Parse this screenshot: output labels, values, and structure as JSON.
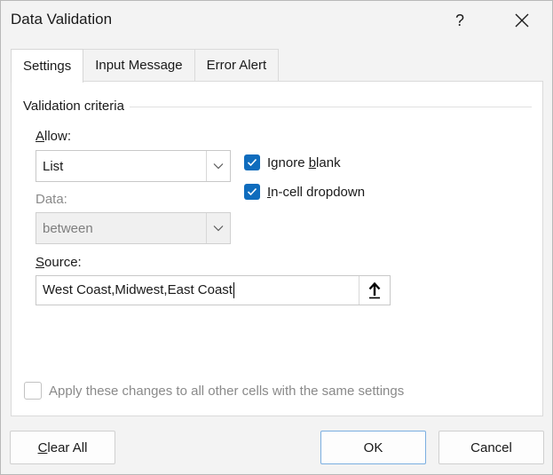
{
  "window": {
    "title": "Data Validation",
    "help_label": "?"
  },
  "tabs": [
    {
      "label": "Settings",
      "active": true
    },
    {
      "label": "Input Message",
      "active": false
    },
    {
      "label": "Error Alert",
      "active": false
    }
  ],
  "settings": {
    "group_label": "Validation criteria",
    "allow": {
      "label_mnemonic": "A",
      "label_rest": "llow:",
      "value": "List"
    },
    "data": {
      "label": "Data:",
      "value": "between"
    },
    "ignore_blank": {
      "label_before": "Ignore ",
      "label_mnemonic": "b",
      "label_after": "lank",
      "checked": true
    },
    "in_cell_dropdown": {
      "label_mnemonic": "I",
      "label_rest": "n-cell dropdown",
      "checked": true
    },
    "source": {
      "label_mnemonic": "S",
      "label_rest": "ource:",
      "value": "West Coast,Midwest,East Coast"
    },
    "apply_all": {
      "label": "Apply these changes to all other cells with the same settings",
      "checked": false
    }
  },
  "buttons": {
    "clear_all_mnemonic": "C",
    "clear_all_rest": "lear All",
    "ok": "OK",
    "cancel": "Cancel"
  },
  "colors": {
    "accent": "#0f6cbd",
    "disabled_text": "#8a8a8a"
  }
}
